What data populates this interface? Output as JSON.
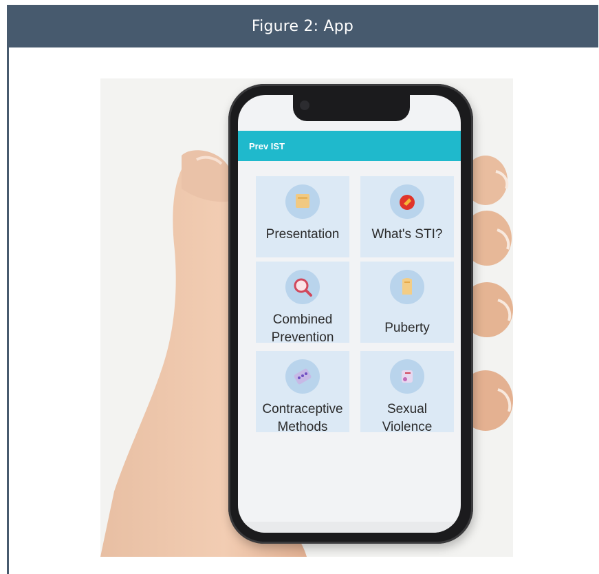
{
  "figure": {
    "title": "Figure 2: App",
    "header_color": "#475a6e"
  },
  "app": {
    "title": "Prev IST",
    "bar_color": "#1fb9cc",
    "tiles": [
      {
        "label_line1": "Presentation",
        "label_line2": "",
        "icon": "presentation-icon"
      },
      {
        "label_line1": "What's STI?",
        "label_line2": "",
        "icon": "sti-info-icon"
      },
      {
        "label_line1": "Combined",
        "label_line2": "Prevention",
        "icon": "magnifier-icon"
      },
      {
        "label_line1": "Puberty",
        "label_line2": "",
        "icon": "puberty-icon"
      },
      {
        "label_line1": "Contraceptive",
        "label_line2": "Methods",
        "icon": "pill-pack-icon"
      },
      {
        "label_line1": "Sexual",
        "label_line2": "Violence",
        "icon": "violence-icon"
      }
    ]
  }
}
